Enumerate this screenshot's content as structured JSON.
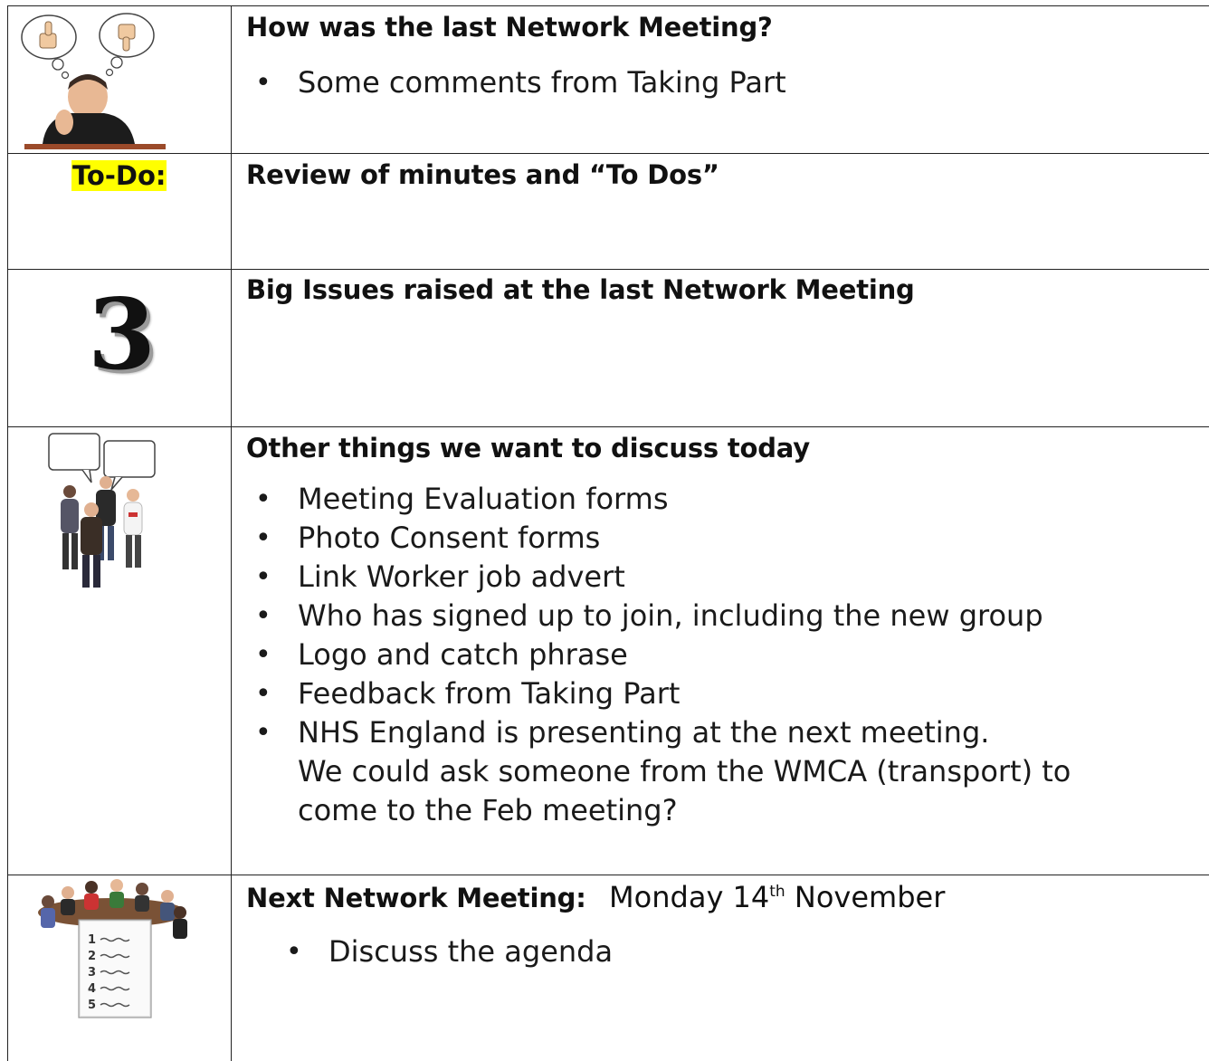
{
  "rows": [
    {
      "heading": "How was the last Network Meeting?",
      "items": [
        "Some comments from Taking Part"
      ]
    },
    {
      "badge": "To-Do:",
      "heading": "Review of minutes and “To Dos”"
    },
    {
      "number": "3",
      "heading": "Big Issues raised at the last Network Meeting"
    },
    {
      "heading": "Other things we want to discuss today",
      "items": [
        "Meeting Evaluation forms",
        "Photo Consent forms",
        "Link Worker job advert",
        "Who has signed up to join, including the new group",
        "Logo and catch phrase",
        "Feedback from Taking Part",
        "NHS England is presenting at the next meeting.\nWe could ask someone from the WMCA (transport) to come to the Feb meeting?"
      ]
    },
    {
      "heading": "Next Network Meeting:",
      "date_prefix": "Monday 14",
      "date_suffix": "th",
      "date_month": "November",
      "items": [
        "Discuss the agenda"
      ],
      "agenda_numbers": [
        "1",
        "2",
        "3",
        "4",
        "5"
      ]
    }
  ],
  "icons": {
    "row1": "thinking-person-thumbs-icon",
    "row4": "group-discussion-icon",
    "row5": "meeting-agenda-icon"
  }
}
